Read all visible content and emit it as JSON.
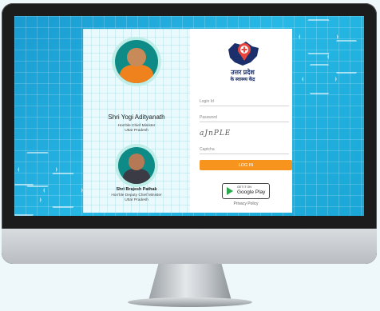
{
  "left": {
    "person1": {
      "name": "Shri Yogi Adityanath",
      "role": "Hon'ble Chief Minister",
      "state": "Uttar Pradesh"
    },
    "person2": {
      "name": "Shri Brajesh Pathak",
      "role": "Hon'ble Deputy Chief Minister",
      "state": "Uttar Pradesh"
    }
  },
  "logo": {
    "line1": "उत्तर प्रदेश",
    "line2": "के स्वास्थ्य केंद्र"
  },
  "form": {
    "login_id_placeholder": "Login Id",
    "password_placeholder": "Password",
    "captcha_text": "aJnPLE",
    "captcha_placeholder": "Captcha",
    "login_label": "LOG IN"
  },
  "store": {
    "small": "GET IT ON",
    "big": "Google Play"
  },
  "footer": {
    "privacy": "Privacy Policy"
  },
  "colors": {
    "accent": "#f7941d",
    "screen_bg": "#1fa8dc",
    "logo_red": "#e8453c",
    "logo_navy": "#1a2f6b"
  }
}
